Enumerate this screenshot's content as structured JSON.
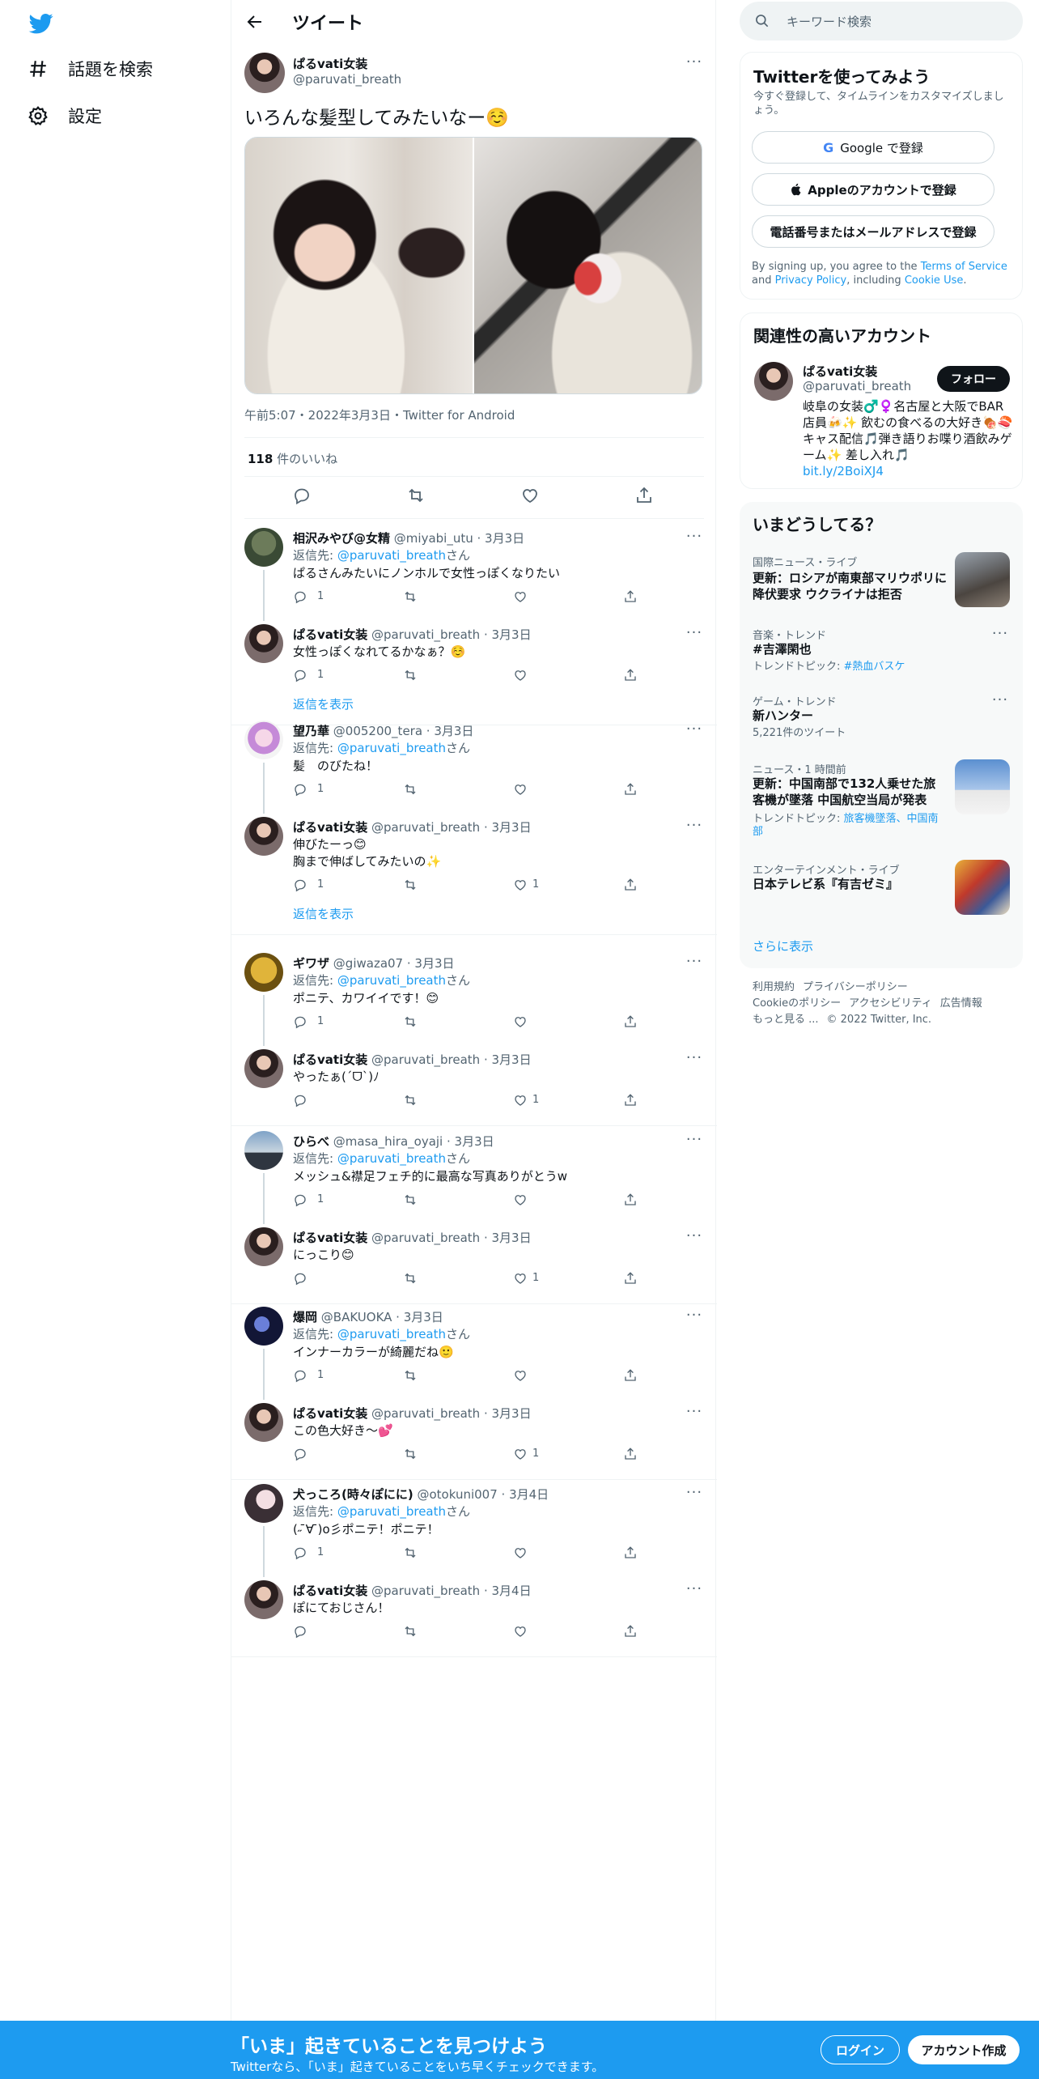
{
  "nav": {
    "explore": "話題を検索",
    "settings": "設定"
  },
  "header": {
    "title": "ツイート"
  },
  "main_tweet": {
    "name": "ぱるvati女装",
    "handle": "@paruvati_breath",
    "text": "いろんな髪型してみたいなー☺️",
    "meta": "午前5:07・2022年3月3日・Twitter for Android",
    "likes_count": "118",
    "likes_label": " 件のいいね"
  },
  "reply_to_label": "返信先: ",
  "reply_to_suffix": "さん",
  "show_replies": "返信を表示",
  "replies": [
    {
      "name": "相沢みやび@女精",
      "handle": "@miyabi_utu",
      "date": "3月3日",
      "reply_to": "@paruvati_breath",
      "text": "ぱるさんみたいにノンホルで女性っぽくなりたい",
      "reply_count": "1",
      "like_count": ""
    },
    {
      "name": "ぱるvati女装",
      "handle": "@paruvati_breath",
      "date": "3月3日",
      "text": "女性っぽくなれてるかなぁ？☺️",
      "reply_count": "1",
      "like_count": ""
    },
    {
      "name": "望乃華",
      "handle": "@005200_tera",
      "date": "3月3日",
      "reply_to": "@paruvati_breath",
      "text": "髪　のびたね！",
      "reply_count": "1",
      "like_count": ""
    },
    {
      "name": "ぱるvati女装",
      "handle": "@paruvati_breath",
      "date": "3月3日",
      "text1": "伸びたーっ😊",
      "text2": "胸まで伸ばしてみたいの✨",
      "reply_count": "1",
      "like_count": "1"
    },
    {
      "name": "ギワザ",
      "handle": "@giwaza07",
      "date": "3月3日",
      "reply_to": "@paruvati_breath",
      "text": "ポニテ、カワイイです！😊",
      "reply_count": "1",
      "like_count": ""
    },
    {
      "name": "ぱるvati女装",
      "handle": "@paruvati_breath",
      "date": "3月3日",
      "text": "やったぁ(´ᗜ`)ﾉ",
      "reply_count": "",
      "like_count": "1"
    },
    {
      "name": "ひらべ",
      "handle": "@masa_hira_oyaji",
      "date": "3月3日",
      "reply_to": "@paruvati_breath",
      "text": "メッシュ&襟足フェチ的に最高な写真ありがとうw",
      "reply_count": "1",
      "like_count": ""
    },
    {
      "name": "ぱるvati女装",
      "handle": "@paruvati_breath",
      "date": "3月3日",
      "text": "にっこり😊",
      "reply_count": "",
      "like_count": "1"
    },
    {
      "name": "爆岡",
      "handle": "@BAKUOKA",
      "date": "3月3日",
      "reply_to": "@paruvati_breath",
      "text": "インナーカラーが綺麗だね🙂",
      "reply_count": "1",
      "like_count": ""
    },
    {
      "name": "ぱるvati女装",
      "handle": "@paruvati_breath",
      "date": "3月3日",
      "text": "この色大好き～💕",
      "reply_count": "",
      "like_count": "1"
    },
    {
      "name": "犬っころ(時々ぽにに)",
      "handle": "@otokuni007",
      "date": "3月4日",
      "reply_to": "@paruvati_breath",
      "text": "(˶ ̄∀ ̄)o彡ポニテ！ポニテ！",
      "reply_count": "1",
      "like_count": ""
    },
    {
      "name": "ぱるvati女装",
      "handle": "@paruvati_breath",
      "date": "3月4日",
      "text": "ぽにておじさん！",
      "reply_count": "",
      "like_count": ""
    }
  ],
  "search": {
    "placeholder": "キーワード検索"
  },
  "signup": {
    "title": "Twitterを使ってみよう",
    "subtitle": "今すぐ登録して、タイムラインをカスタマイズしましょう。",
    "google": "Google で登録",
    "apple": "Appleのアカウントで登録",
    "phone": "電話番号またはメールアドレスで登録",
    "terms_pre": "By signing up, you agree to the ",
    "terms_tos": "Terms of Service",
    "terms_and": " and ",
    "terms_privacy": "Privacy Policy",
    "terms_incl": ", including ",
    "terms_cookie": "Cookie Use",
    "terms_end": "."
  },
  "related": {
    "title": "関連性の高いアカウント",
    "name": "ぱるvati女装",
    "handle": "@paruvati_breath",
    "follow": "フォロー",
    "bio": "岐阜の女装♂️♀️名古屋と大阪でBAR店員🍻✨ 飲むの食べるの大好き🍖🍣 キャス配信🎵弾き語りお喋り酒飲みゲーム✨ 差し入れ🎵",
    "link": "bit.ly/2BoiXJ4"
  },
  "trends": {
    "title": "いまどうしてる？",
    "items": [
      {
        "category": "国際ニュース・ライブ",
        "title": "更新：ロシアが南東部マリウポリに降伏要求 ウクライナは拒否"
      },
      {
        "category": "音楽・トレンド",
        "title": "#吉澤閑也",
        "sub_label": "トレンドトピック: ",
        "sub_link": "#熱血バスケ"
      },
      {
        "category": "ゲーム・トレンド",
        "title": "新ハンター",
        "sub": "5,221件のツイート"
      },
      {
        "category": "ニュース・1 時間前",
        "title": "更新：中国南部で132人乗せた旅客機が墜落 中国航空当局が発表",
        "sub_label": "トレンドトピック: ",
        "sub_link": "旅客機墜落、中国南部"
      },
      {
        "category": "エンターテインメント・ライブ",
        "title": "日本テレビ系『有吉ゼミ』"
      }
    ],
    "show_more": "さらに表示"
  },
  "footer": {
    "links1": [
      "利用規約",
      "プライバシーポリシー"
    ],
    "links2": [
      "Cookieのポリシー",
      "アクセシビリティ",
      "広告情報"
    ],
    "more": "もっと見る ...",
    "copyright": "© 2022 Twitter, Inc."
  },
  "bottom_bar": {
    "title": "「いま」起きていることを見つけよう",
    "subtitle": "Twitterなら、「いま」起きていることをいち早くチェックできます。",
    "login": "ログイン",
    "signup": "アカウント作成"
  },
  "colors": {
    "accent": "#1d9bf0",
    "text": "#0f1419",
    "secondary": "#536471"
  }
}
